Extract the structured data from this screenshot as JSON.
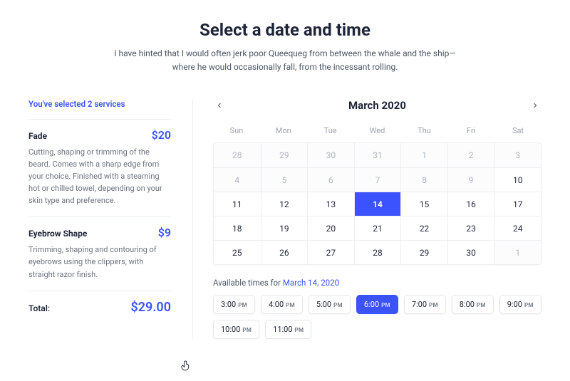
{
  "heading": {
    "title": "Select a date and time",
    "subtitle": "I have hinted that I would often jerk poor Queequeg from between the whale and the ship—where he would occasionally fall, from the incessant rolling."
  },
  "summary": {
    "header": "You've selected 2 services",
    "services": [
      {
        "name": "Fade",
        "price": "$20",
        "desc": "Cutting, shaping or trimming of the beard. Comes with a sharp edge from your choice. Finished with a steaming hot or chilled towel, depending on your skin type and preference."
      },
      {
        "name": "Eyebrow Shape",
        "price": "$9",
        "desc": "Trimming, shaping and contouring of eyebrows using the clippers, with straight razor finish."
      }
    ],
    "total_label": "Total:",
    "total_value": "$29.00"
  },
  "calendar": {
    "month": "March 2020",
    "dow": [
      "Sun",
      "Mon",
      "Tue",
      "Wed",
      "Thu",
      "Fri",
      "Sat"
    ],
    "weeks": [
      [
        {
          "n": "28",
          "disabled": true
        },
        {
          "n": "29",
          "disabled": true
        },
        {
          "n": "30",
          "disabled": true
        },
        {
          "n": "31",
          "disabled": true
        },
        {
          "n": "1",
          "disabled": true
        },
        {
          "n": "2",
          "disabled": true
        },
        {
          "n": "3",
          "disabled": true
        }
      ],
      [
        {
          "n": "4",
          "disabled": true
        },
        {
          "n": "5",
          "disabled": true
        },
        {
          "n": "6",
          "disabled": true
        },
        {
          "n": "7",
          "disabled": true
        },
        {
          "n": "8",
          "disabled": true
        },
        {
          "n": "9",
          "disabled": true
        },
        {
          "n": "10"
        }
      ],
      [
        {
          "n": "11"
        },
        {
          "n": "12"
        },
        {
          "n": "13"
        },
        {
          "n": "14",
          "selected": true
        },
        {
          "n": "15"
        },
        {
          "n": "16"
        },
        {
          "n": "17"
        }
      ],
      [
        {
          "n": "18"
        },
        {
          "n": "19"
        },
        {
          "n": "20"
        },
        {
          "n": "21"
        },
        {
          "n": "22"
        },
        {
          "n": "23"
        },
        {
          "n": "24"
        }
      ],
      [
        {
          "n": "25"
        },
        {
          "n": "26"
        },
        {
          "n": "27"
        },
        {
          "n": "28"
        },
        {
          "n": "29"
        },
        {
          "n": "30"
        },
        {
          "n": "1",
          "disabled": true
        }
      ]
    ]
  },
  "available": {
    "label": "Available times for ",
    "date": "March 14, 2020",
    "slots": [
      {
        "t": "3:00",
        "ap": "PM"
      },
      {
        "t": "4:00",
        "ap": "PM"
      },
      {
        "t": "5:00",
        "ap": "PM"
      },
      {
        "t": "6:00",
        "ap": "PM",
        "selected": true
      },
      {
        "t": "7:00",
        "ap": "PM"
      },
      {
        "t": "8:00",
        "ap": "PM"
      },
      {
        "t": "9:00",
        "ap": "PM"
      },
      {
        "t": "10:00",
        "ap": "PM"
      },
      {
        "t": "11:00",
        "ap": "PM"
      }
    ]
  }
}
